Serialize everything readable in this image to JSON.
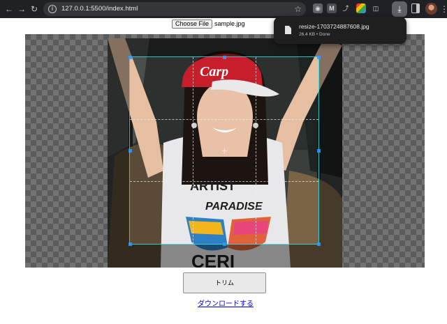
{
  "browser": {
    "url": "127.0.0.1:5500/index.html",
    "icons": {
      "back": "arrow-left-icon",
      "forward": "arrow-right-icon",
      "reload": "reload-icon",
      "site_info": "info-icon",
      "bookmark": "star-icon",
      "downloads": "download-icon",
      "side_panel": "side-panel-icon",
      "menu": "kebab-menu-icon"
    },
    "extension_labels": {
      "m": "M"
    }
  },
  "download_bubble": {
    "filename": "resize-1703724887608.jpg",
    "status": "26.4 KB • Done"
  },
  "file_input": {
    "button_label": "Choose File",
    "selected_file": "sample.jpg"
  },
  "cropper": {
    "background": "checkerboard"
  },
  "actions": {
    "trim_label": "トリム",
    "download_link_label": "ダウンロードする"
  },
  "colors": {
    "accent": "#3399ff",
    "link": "#0000ee",
    "chrome_bg": "#202124",
    "bubble_bg": "#1f1f1f"
  }
}
